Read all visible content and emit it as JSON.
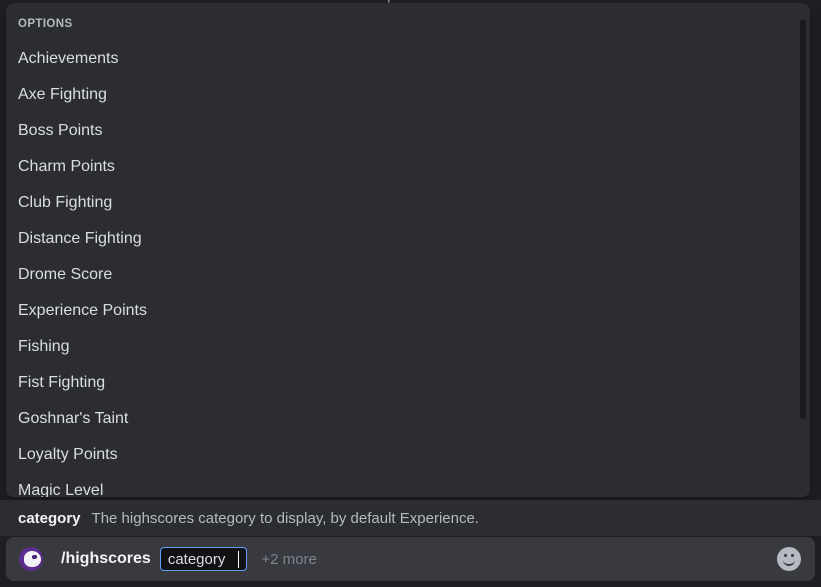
{
  "autocomplete": {
    "header": "OPTIONS",
    "options": [
      {
        "label": "Achievements"
      },
      {
        "label": "Axe Fighting"
      },
      {
        "label": "Boss Points"
      },
      {
        "label": "Charm Points"
      },
      {
        "label": "Club Fighting"
      },
      {
        "label": "Distance Fighting"
      },
      {
        "label": "Drome Score"
      },
      {
        "label": "Experience Points"
      },
      {
        "label": "Fishing"
      },
      {
        "label": "Fist Fighting"
      },
      {
        "label": "Goshnar's Taint"
      },
      {
        "label": "Loyalty Points"
      },
      {
        "label": "Magic Level"
      }
    ],
    "scrollbar": {
      "name": "options-scrollbar"
    }
  },
  "argument_hint": {
    "name": "category",
    "description": "The highscores category to display, by default Experience."
  },
  "input_bar": {
    "avatar_name": "bot-avatar",
    "command": "/highscores",
    "active_argument": "category",
    "more_arguments": "+2 more",
    "emoji_button_name": "emoji-picker-button"
  },
  "clipped_top_text": "y",
  "colors": {
    "popup_background": "#2b2d31",
    "input_background": "#383a40",
    "page_background": "#1e1f22",
    "option_text": "#dbdee1",
    "muted_text": "#b5bac1",
    "dim_text": "#80848e",
    "accent_border": "#5e9eff",
    "chip_background": "#111214",
    "avatar_purple": "#5b2d8e"
  }
}
